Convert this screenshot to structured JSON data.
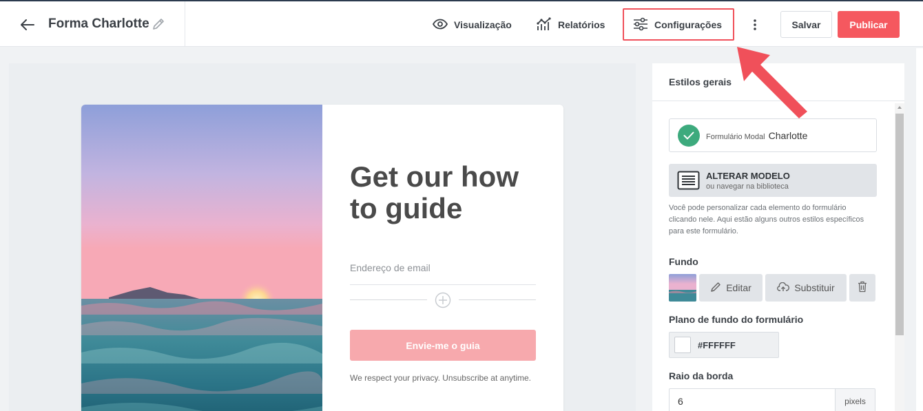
{
  "header": {
    "title": "Forma Charlotte",
    "nav": {
      "preview": "Visualização",
      "reports": "Relatórios",
      "settings": "Configurações"
    },
    "save_label": "Salvar",
    "publish_label": "Publicar"
  },
  "form_preview": {
    "heading": "Get our how to guide",
    "email_placeholder": "Endereço de email",
    "submit_label": "Envie-me o guia",
    "privacy_text": "We respect your privacy. Unsubscribe at anytime."
  },
  "panel": {
    "title": "Estilos gerais",
    "template": {
      "prefix": "Formulário Modal",
      "name": "Charlotte"
    },
    "change_template": {
      "title": "ALTERAR MODELO",
      "subtitle": "ou navegar na biblioteca"
    },
    "description": "Você pode personalizar cada elemento do formulário clicando nele. Aqui estão alguns outros estilos específicos para este formulário.",
    "background": {
      "label": "Fundo",
      "edit_label": "Editar",
      "replace_label": "Substituir"
    },
    "form_background": {
      "label": "Plano de fundo do formulário",
      "value": "#FFFFFF"
    },
    "border_radius": {
      "label": "Raio da borda",
      "value": "6",
      "unit": "pixels"
    }
  },
  "colors": {
    "accent": "#f5585f",
    "submit_disabled": "#f7a9ad",
    "success": "#3daa7d",
    "annotation": "#f0505a"
  },
  "icons": [
    "arrow-left-icon",
    "pencil-icon",
    "eye-icon",
    "chart-icon",
    "sliders-icon",
    "kebab-icon",
    "plus-circle-icon",
    "check-icon",
    "template-icon",
    "edit-icon",
    "cloud-upload-icon",
    "trash-icon"
  ]
}
